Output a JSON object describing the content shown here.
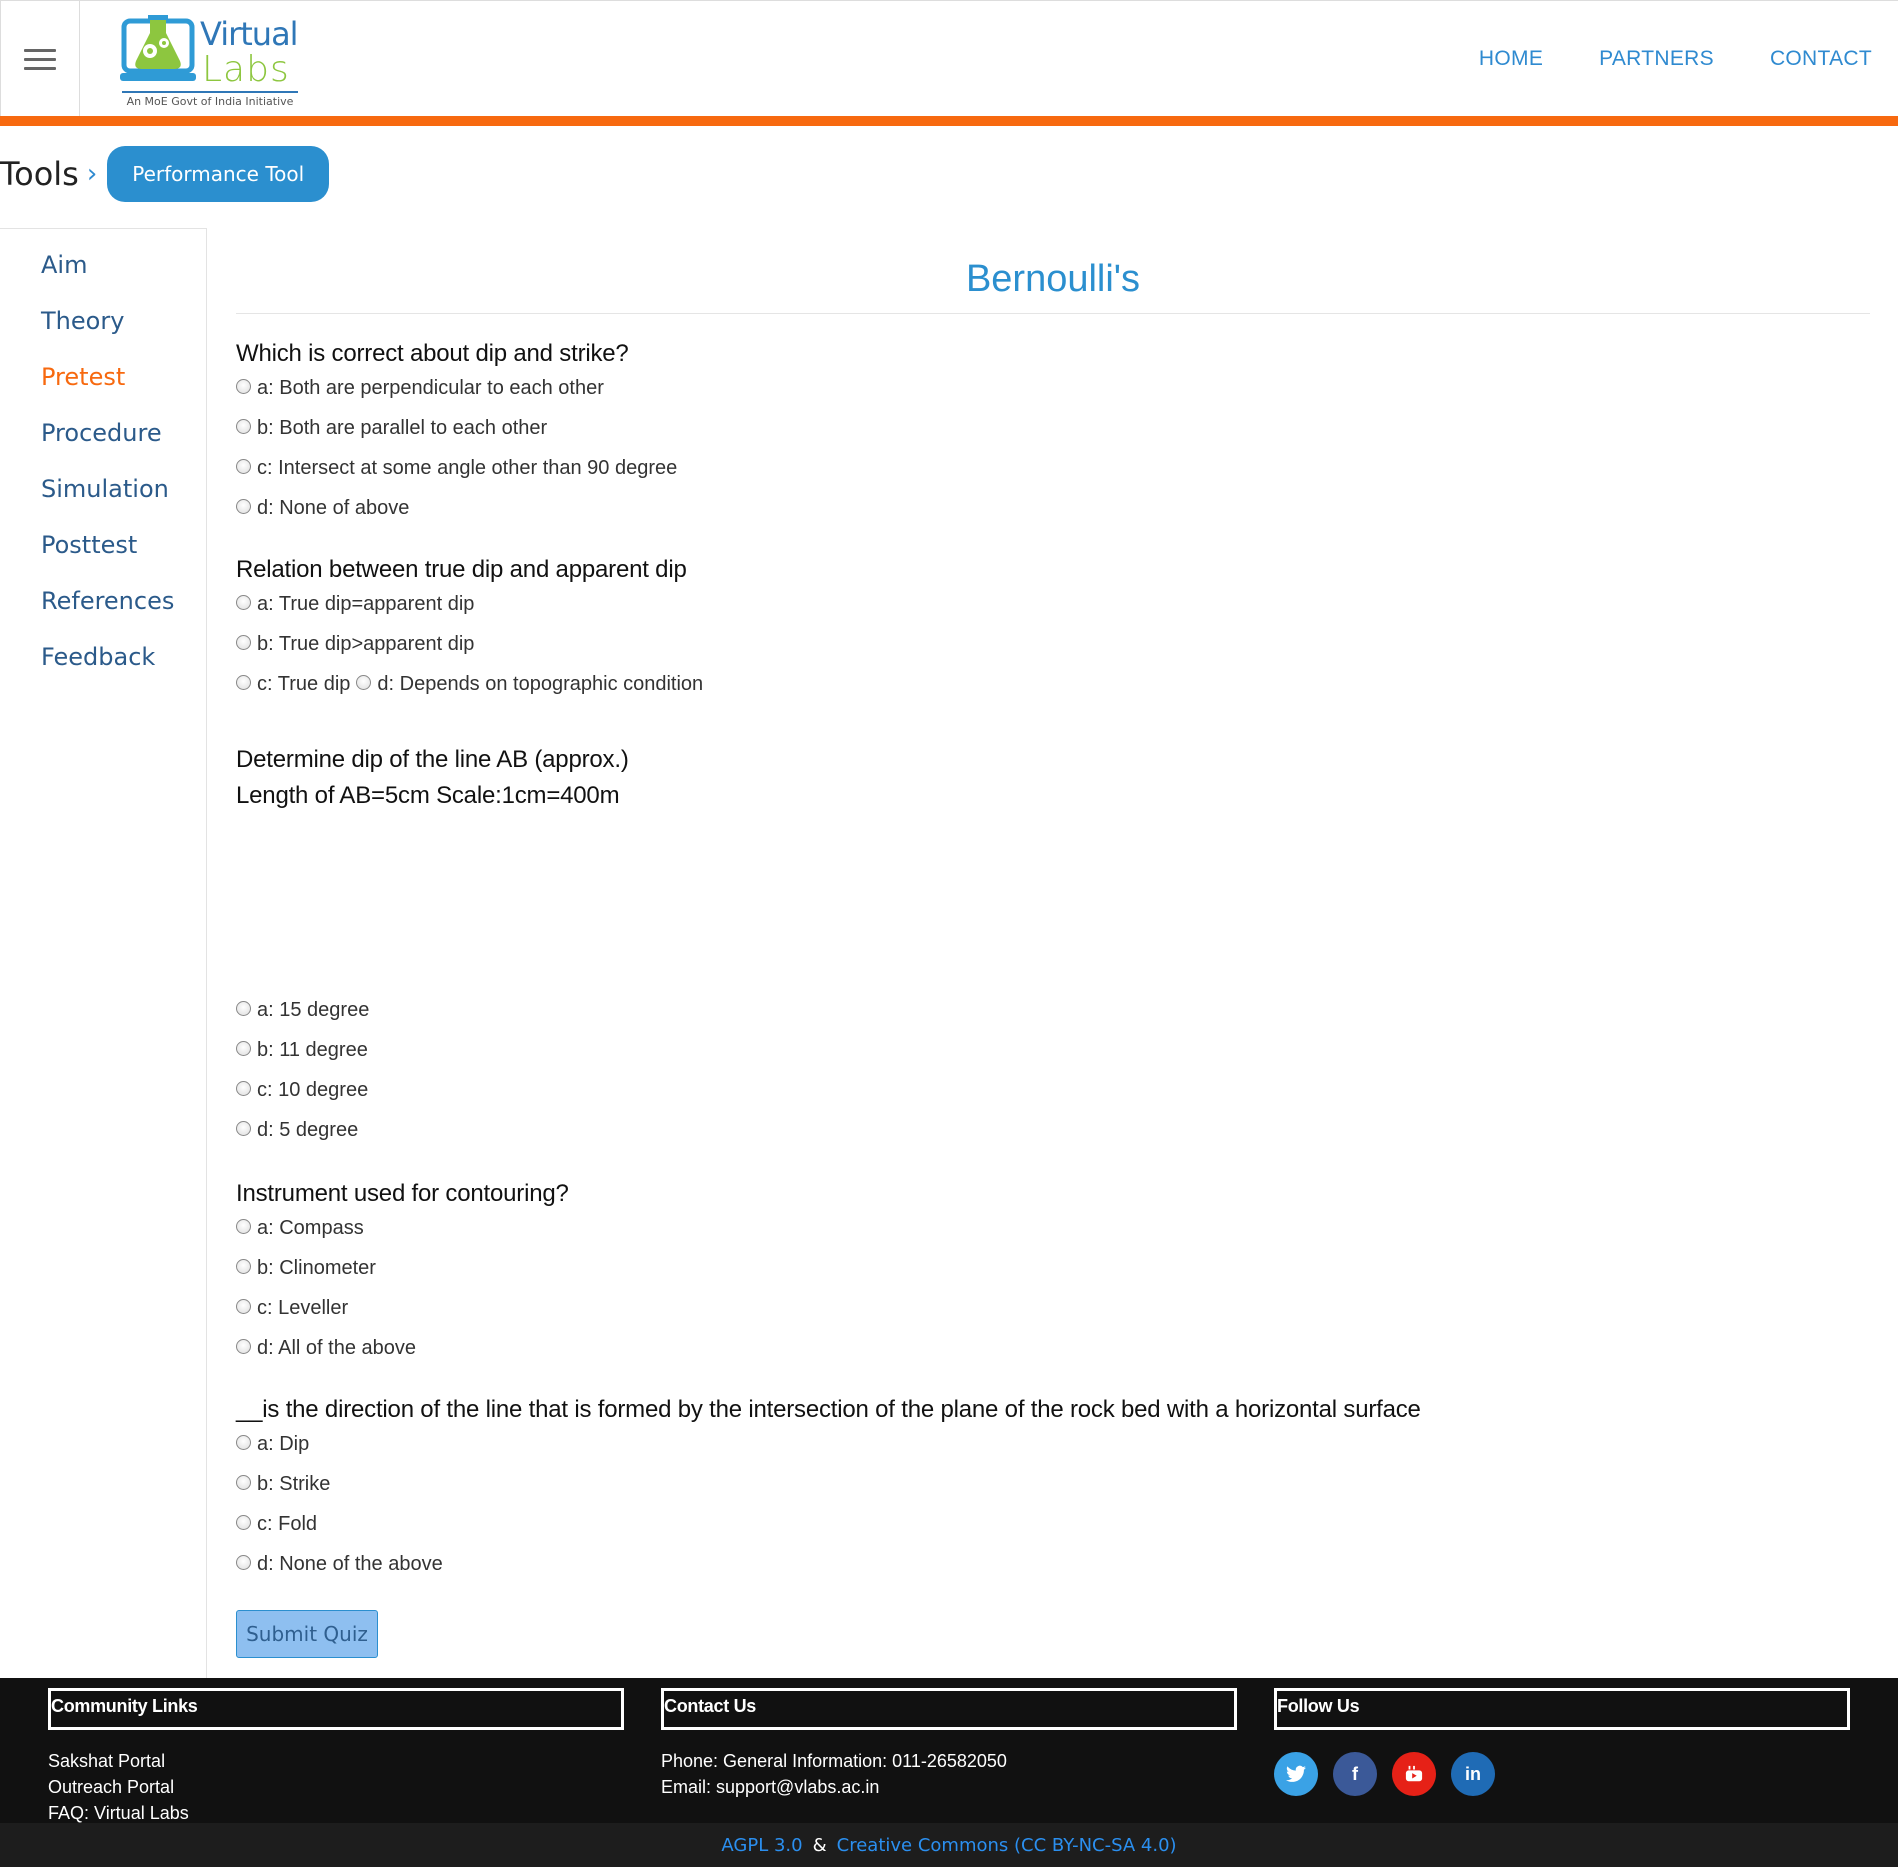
{
  "header": {
    "logo_title_1": "Virtual",
    "logo_title_2": "Labs",
    "logo_tagline": "An MoE Govt of India Initiative",
    "nav": [
      "HOME",
      "PARTNERS",
      "CONTACT"
    ]
  },
  "breadcrumb": {
    "root": "Tools",
    "current": "Performance Tool"
  },
  "sidebar": {
    "items": [
      {
        "label": "Aim"
      },
      {
        "label": "Theory"
      },
      {
        "label": "Pretest"
      },
      {
        "label": "Procedure"
      },
      {
        "label": "Simulation"
      },
      {
        "label": "Posttest"
      },
      {
        "label": "References"
      },
      {
        "label": "Feedback"
      }
    ],
    "active": "Pretest"
  },
  "quiz": {
    "title": "Bernoulli's",
    "questions": [
      {
        "text": "Which is correct about dip and strike?",
        "options": [
          "a: Both are perpendicular to each other",
          "b: Both are parallel to each other",
          "c: Intersect at some angle other than 90 degree",
          "d: None of above"
        ]
      },
      {
        "text": "Relation between true dip and apparent dip",
        "options": [
          "a: True dip=apparent dip",
          "b: True dip>apparent dip",
          "c: True dip",
          "d: Depends on topographic condition"
        ]
      },
      {
        "text": "Determine dip of the line AB (approx.)",
        "text2": "Length of AB=5cm Scale:1cm=400m",
        "options": [
          "a: 15 degree",
          "b: 11 degree",
          "c: 10 degree",
          "d: 5 degree"
        ]
      },
      {
        "text": "Instrument used for contouring?",
        "options": [
          "a: Compass",
          "b: Clinometer",
          "c: Leveller",
          "d: All of the above"
        ]
      },
      {
        "text": "__is the direction of the line that is formed by the intersection of the plane of the rock bed with a horizontal surface",
        "options": [
          "a: Dip",
          "b: Strike",
          "c: Fold",
          "d: None of the above"
        ]
      }
    ],
    "submit_label": "Submit Quiz"
  },
  "footer": {
    "community": {
      "heading": "Community Links",
      "links": [
        "Sakshat Portal",
        "Outreach Portal",
        "FAQ: Virtual Labs"
      ]
    },
    "contact": {
      "heading": "Contact Us",
      "phone": "Phone: General Information: 011-26582050",
      "email": "Email: support@vlabs.ac.in"
    },
    "follow": {
      "heading": "Follow Us",
      "icons": [
        "twitter-icon",
        "facebook-icon",
        "youtube-icon",
        "linkedin-icon"
      ],
      "colors": [
        "#3aa2e6",
        "#3b5998",
        "#e62117",
        "#1f6bb5"
      ]
    },
    "license_1": "AGPL 3.0",
    "license_sep": "&",
    "license_2": "Creative Commons (CC BY-NC-SA 4.0)"
  },
  "colors": {
    "accent_orange": "#f7690f",
    "accent_blue": "#2b8fcf"
  }
}
